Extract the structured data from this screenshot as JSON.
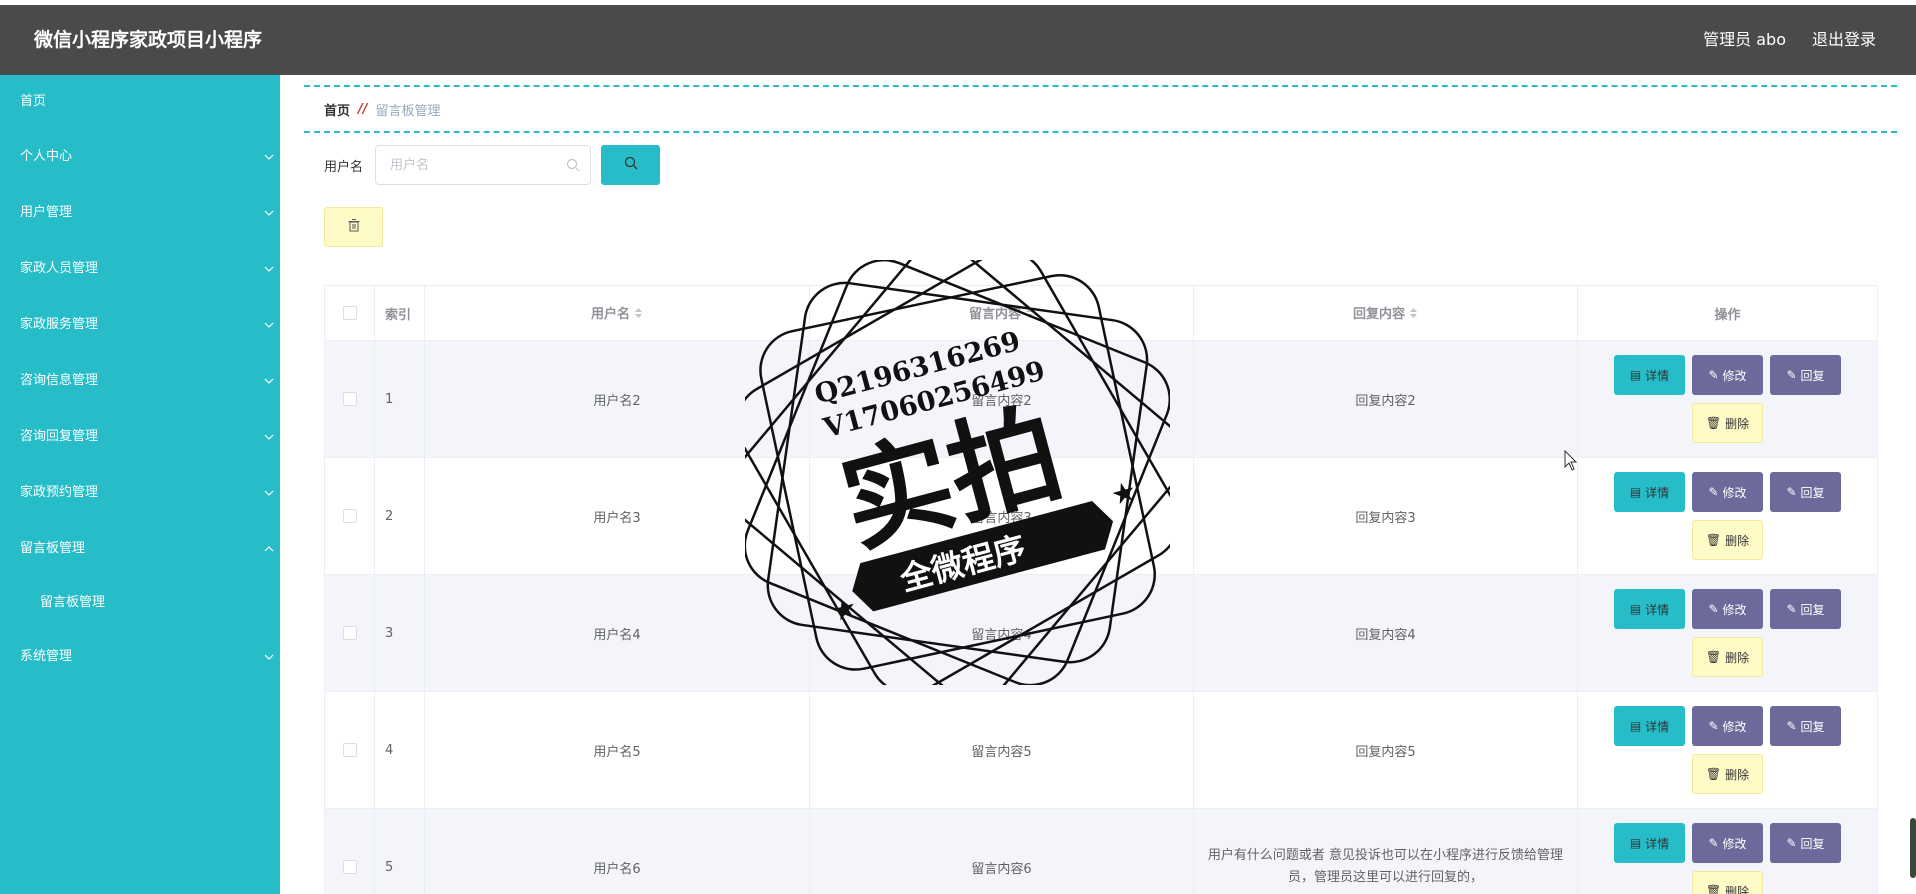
{
  "header": {
    "title": "微信小程序家政项目小程序",
    "user": "管理员 abo",
    "logout": "退出登录"
  },
  "sidebar": {
    "items": [
      {
        "label": "首页",
        "chevron": ""
      },
      {
        "label": "个人中心",
        "chevron": "down"
      },
      {
        "label": "用户管理",
        "chevron": "down"
      },
      {
        "label": "家政人员管理",
        "chevron": "down"
      },
      {
        "label": "家政服务管理",
        "chevron": "down"
      },
      {
        "label": "咨询信息管理",
        "chevron": "down"
      },
      {
        "label": "咨询回复管理",
        "chevron": "down"
      },
      {
        "label": "家政预约管理",
        "chevron": "down"
      },
      {
        "label": "留言板管理",
        "chevron": "up"
      },
      {
        "label": "留言板管理",
        "chevron": ""
      },
      {
        "label": "系统管理",
        "chevron": "down"
      }
    ]
  },
  "breadcrumb": {
    "home": "首页",
    "sep": "//",
    "current": "留言板管理"
  },
  "search": {
    "label": "用户名",
    "placeholder": "用户名",
    "value": ""
  },
  "table": {
    "headers": [
      "",
      "索引",
      "用户名",
      "留言内容",
      "回复内容",
      "操作"
    ],
    "rows": [
      {
        "index": "1",
        "user": "用户名2",
        "message": "留言内容2",
        "reply": "回复内容2"
      },
      {
        "index": "2",
        "user": "用户名3",
        "message": "留言内容3",
        "reply": "回复内容3"
      },
      {
        "index": "3",
        "user": "用户名4",
        "message": "留言内容4",
        "reply": "回复内容4"
      },
      {
        "index": "4",
        "user": "用户名5",
        "message": "留言内容5",
        "reply": "回复内容5"
      },
      {
        "index": "5",
        "user": "用户名6",
        "message": "留言内容6",
        "reply": "用户有什么问题或者 意见投诉也可以在小程序进行反馈给管理员，管理员这里可以进行回复的，"
      }
    ]
  },
  "actions": {
    "detail": "详情",
    "edit": "修改",
    "reply": "回复",
    "delete": "删除"
  },
  "watermark": {
    "line1": "Q2196316269",
    "line2": "V17060256499",
    "main": "实拍",
    "banner": "全微程序"
  },
  "colors": {
    "topbar": "#4a4a4a",
    "sidebar": "#27bdc8",
    "accent": "#27bdc8",
    "purple": "#6b6a9b",
    "yellow": "#fffbc6"
  }
}
